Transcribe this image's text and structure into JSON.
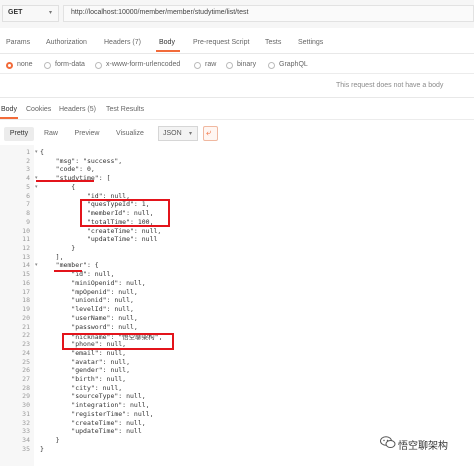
{
  "request": {
    "method": "GET",
    "url": "http://localhost:10000/member/member/studytime/list/test"
  },
  "request_tabs": [
    "Params",
    "Authorization",
    "Headers (7)",
    "Body",
    "Pre-request Script",
    "Tests",
    "Settings"
  ],
  "active_request_tab": "Body",
  "body_types": [
    "none",
    "form-data",
    "x-www-form-urlencoded",
    "raw",
    "binary",
    "GraphQL"
  ],
  "selected_body_type": "none",
  "no_body_message": "This request does not have a body",
  "response_tabs": [
    "Body",
    "Cookies",
    "Headers (5)",
    "Test Results"
  ],
  "active_response_tab": "Body",
  "view_modes": [
    "Pretty",
    "Raw",
    "Preview",
    "Visualize"
  ],
  "active_view_mode": "Pretty",
  "format": "JSON",
  "code_lines": [
    "{",
    "    \"msg\": \"success\",",
    "    \"code\": 0,",
    "    \"studytime\": [",
    "        {",
    "            \"id\": null,",
    "            \"quesTypeId\": 1,",
    "            \"memberId\": null,",
    "            \"totalTime\": 100,",
    "            \"createTime\": null,",
    "            \"updateTime\": null",
    "        }",
    "    ],",
    "    \"member\": {",
    "        \"id\": null,",
    "        \"miniOpenid\": null,",
    "        \"mpOpenid\": null,",
    "        \"unionid\": null,",
    "        \"levelId\": null,",
    "        \"userName\": null,",
    "        \"password\": null,",
    "        \"nickname\": \"悟空聊架构\",",
    "        \"phone\": null,",
    "        \"email\": null,",
    "        \"avatar\": null,",
    "        \"gender\": null,",
    "        \"birth\": null,",
    "        \"city\": null,",
    "        \"sourceType\": null,",
    "        \"integration\": null,",
    "        \"registerTime\": null,",
    "        \"createTime\": null,",
    "        \"updateTime\": null",
    "    }",
    "}"
  ],
  "watermark": "悟空聊架构",
  "colors": {
    "accent": "#f26b3a",
    "highlight": "#e3141b"
  }
}
